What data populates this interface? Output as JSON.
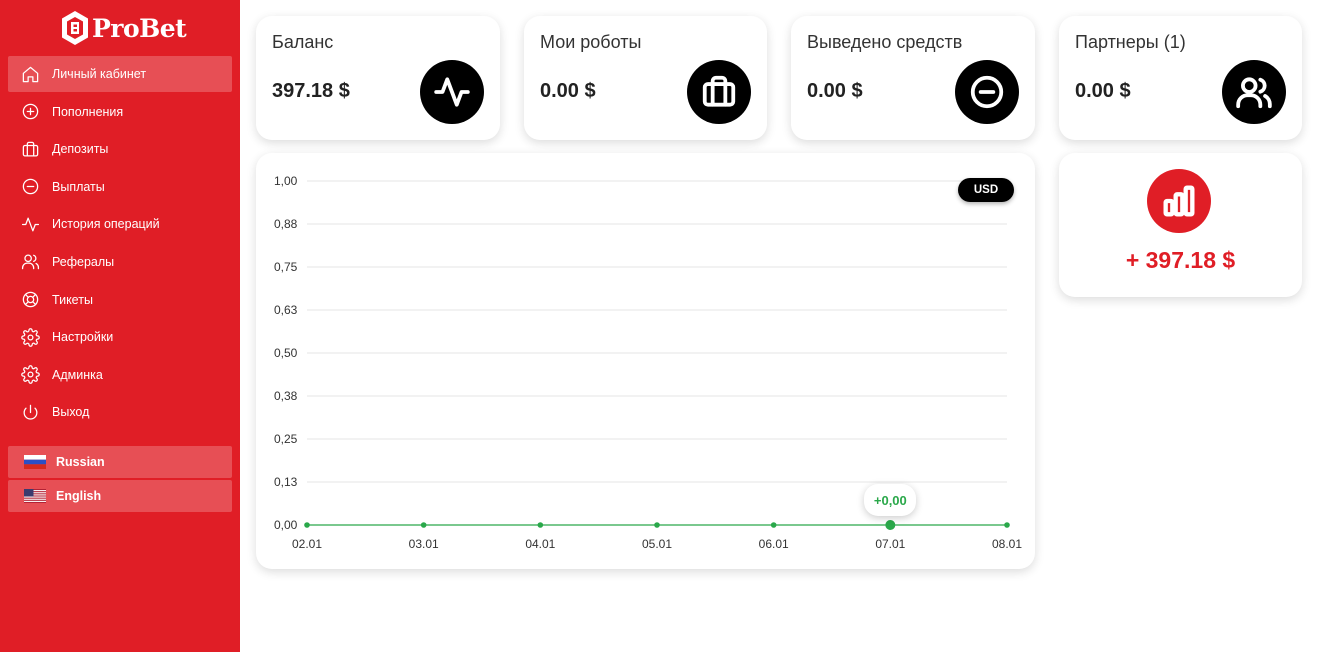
{
  "brand": {
    "name": "ProBet"
  },
  "sidebar": {
    "items": [
      {
        "label": "Личный кабинет",
        "icon": "home-icon",
        "active": true
      },
      {
        "label": "Пополнения",
        "icon": "plus-circle-icon"
      },
      {
        "label": "Депозиты",
        "icon": "briefcase-icon"
      },
      {
        "label": "Выплаты",
        "icon": "minus-circle-icon"
      },
      {
        "label": "История операций",
        "icon": "activity-icon"
      },
      {
        "label": "Рефералы",
        "icon": "users-icon"
      },
      {
        "label": "Тикеты",
        "icon": "lifebuoy-icon"
      },
      {
        "label": "Настройки",
        "icon": "gear-icon"
      },
      {
        "label": "Админка",
        "icon": "gear-icon"
      },
      {
        "label": "Выход",
        "icon": "power-icon"
      }
    ],
    "languages": [
      {
        "label": "Russian",
        "flag": "flag-ru-icon"
      },
      {
        "label": "English",
        "flag": "flag-us-icon"
      }
    ]
  },
  "stats": [
    {
      "title": "Баланс",
      "value": "397.18 $",
      "icon": "activity-icon"
    },
    {
      "title": "Мои роботы",
      "value": "0.00 $",
      "icon": "briefcase-icon"
    },
    {
      "title": "Выведено средств",
      "value": "0.00 $",
      "icon": "minus-circle-icon"
    },
    {
      "title": "Партнеры (1)",
      "value": "0.00 $",
      "icon": "users-icon"
    }
  ],
  "chart": {
    "currency_button": "USD",
    "tooltip": "+0,00"
  },
  "chart_data": {
    "type": "line",
    "categories": [
      "02.01",
      "03.01",
      "04.01",
      "05.01",
      "06.01",
      "07.01",
      "08.01"
    ],
    "series": [
      {
        "values": [
          0,
          0,
          0,
          0,
          0,
          0,
          0
        ],
        "color": "#2aa84a"
      }
    ],
    "y_ticks": [
      "1,00",
      "0,88",
      "0,75",
      "0,63",
      "0,50",
      "0,38",
      "0,25",
      "0,13",
      "0,00"
    ],
    "ylim": [
      0,
      1
    ],
    "grid": true,
    "highlight_index": 5
  },
  "profit": {
    "value": "+ 397.18 $",
    "icon": "bar-chart-icon"
  },
  "colors": {
    "brand_red": "#e01e26",
    "line_green": "#2aa84a"
  }
}
